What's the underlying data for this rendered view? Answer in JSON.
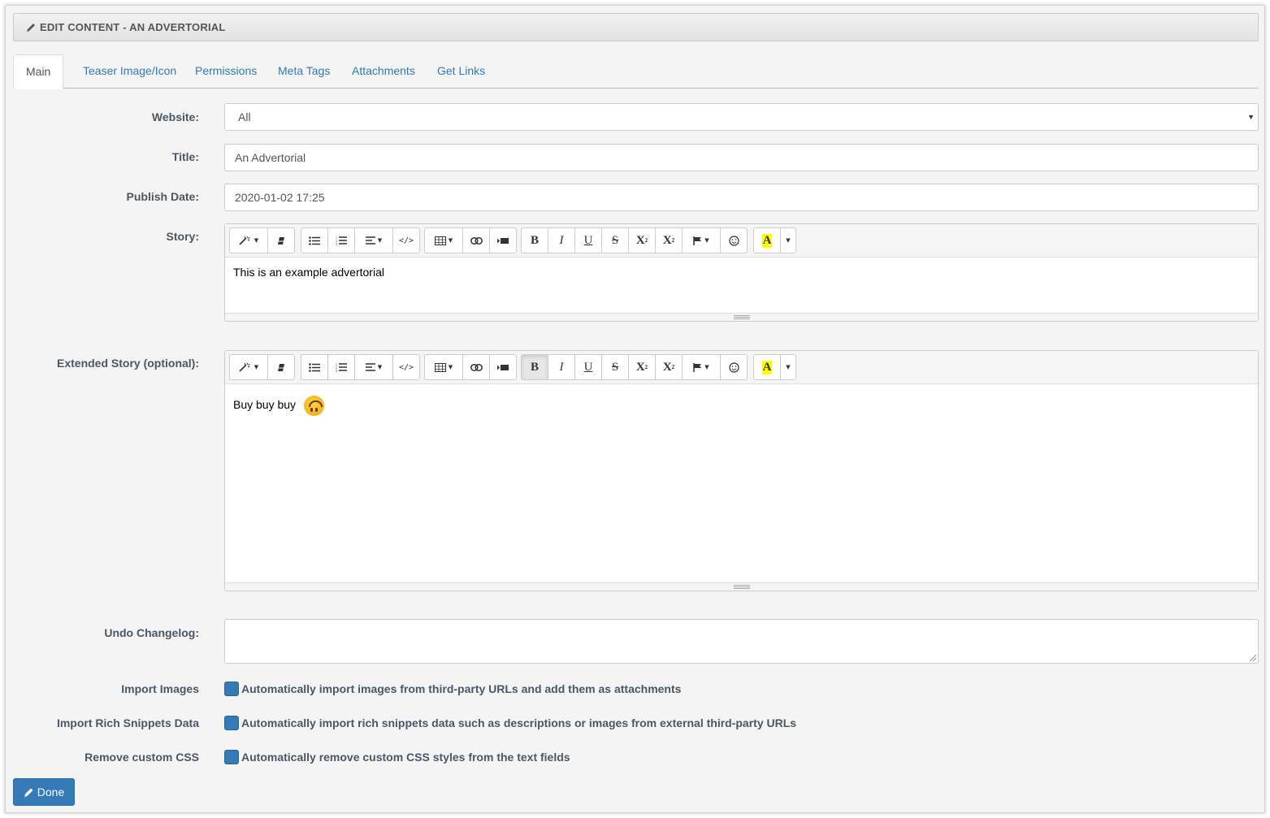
{
  "header": {
    "title": "EDIT CONTENT - AN ADVERTORIAL"
  },
  "tabs": [
    {
      "label": "Main",
      "active": true
    },
    {
      "label": "Teaser Image/Icon"
    },
    {
      "label": "Permissions"
    },
    {
      "label": "Meta Tags"
    },
    {
      "label": "Attachments"
    },
    {
      "label": "Get Links"
    }
  ],
  "form": {
    "website": {
      "label": "Website:",
      "value": "All"
    },
    "title": {
      "label": "Title:",
      "value": "An Advertorial"
    },
    "publish_date": {
      "label": "Publish Date:",
      "value": "2020-01-02 17:25"
    },
    "story": {
      "label": "Story:",
      "content": "This is an example advertorial"
    },
    "extended_story": {
      "label": "Extended Story (optional):",
      "content": "Buy buy buy",
      "emoji": "upside-down-face"
    },
    "undo_changelog": {
      "label": "Undo Changelog:",
      "value": ""
    },
    "import_images": {
      "label": "Import Images",
      "description": "Automatically import images from third-party URLs and add them as attachments"
    },
    "import_rich_snippets": {
      "label": "Import Rich Snippets Data",
      "description": "Automatically import rich snippets data such as descriptions or images from external third-party URLs"
    },
    "remove_css": {
      "label": "Remove custom CSS",
      "description": "Automatically remove custom CSS styles from the text fields"
    }
  },
  "toolbar": {
    "bold": "B",
    "italic": "I",
    "underline": "U",
    "strike": "S",
    "superscript": "X",
    "subscript": "X",
    "highlight": "A"
  },
  "done_button": {
    "label": "Done"
  },
  "colors": {
    "accent": "#337ab7",
    "label": "#4a5766",
    "highlight": "#ffff00"
  }
}
